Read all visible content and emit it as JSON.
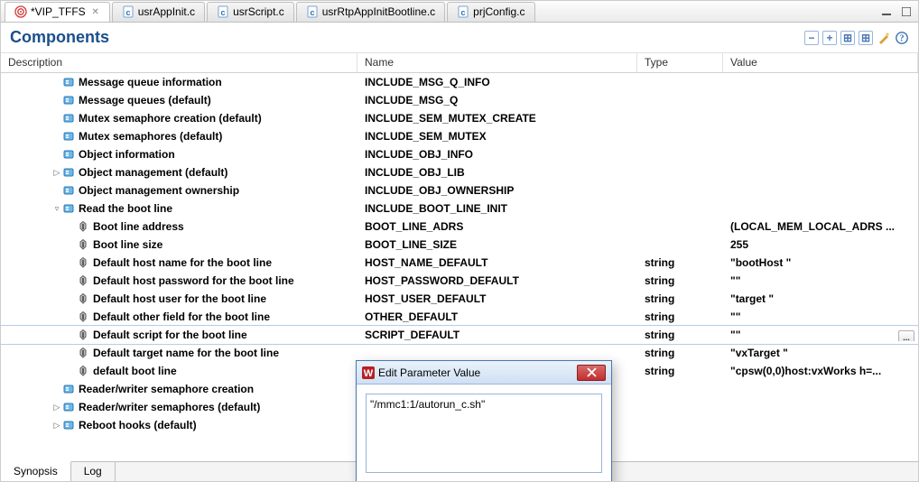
{
  "tabs": [
    {
      "label": "*VIP_TFFS",
      "active": true,
      "close": true,
      "icon": "target"
    },
    {
      "label": "usrAppInit.c",
      "icon": "cfile"
    },
    {
      "label": "usrScript.c",
      "icon": "cfile"
    },
    {
      "label": "usrRtpAppInitBootline.c",
      "icon": "cfile"
    },
    {
      "label": "prjConfig.c",
      "icon": "cfile"
    }
  ],
  "section_title": "Components",
  "columns": {
    "desc": "Description",
    "name": "Name",
    "type": "Type",
    "val": "Value"
  },
  "rows": [
    {
      "indent": 3,
      "twisty": "",
      "icon": "comp",
      "desc": "Message queue information",
      "name": "INCLUDE_MSG_Q_INFO",
      "type": "",
      "val": "",
      "bold": true
    },
    {
      "indent": 3,
      "twisty": "",
      "icon": "comp",
      "desc": "Message queues (default)",
      "name": "INCLUDE_MSG_Q",
      "type": "",
      "val": "",
      "bold": true
    },
    {
      "indent": 3,
      "twisty": "",
      "icon": "comp",
      "desc": "Mutex semaphore creation (default)",
      "name": "INCLUDE_SEM_MUTEX_CREATE",
      "type": "",
      "val": "",
      "bold": true
    },
    {
      "indent": 3,
      "twisty": "",
      "icon": "comp",
      "desc": "Mutex semaphores (default)",
      "name": "INCLUDE_SEM_MUTEX",
      "type": "",
      "val": "",
      "bold": true
    },
    {
      "indent": 3,
      "twisty": "",
      "icon": "comp",
      "desc": "Object information",
      "name": "INCLUDE_OBJ_INFO",
      "type": "",
      "val": "",
      "bold": true
    },
    {
      "indent": 3,
      "twisty": "▷",
      "icon": "comp",
      "desc": "Object management (default)",
      "name": "INCLUDE_OBJ_LIB",
      "type": "",
      "val": "",
      "bold": true
    },
    {
      "indent": 3,
      "twisty": "",
      "icon": "comp",
      "desc": "Object management ownership",
      "name": "INCLUDE_OBJ_OWNERSHIP",
      "type": "",
      "val": "",
      "bold": true
    },
    {
      "indent": 3,
      "twisty": "▿",
      "icon": "comp",
      "desc": "Read the boot line",
      "name": "INCLUDE_BOOT_LINE_INIT",
      "type": "",
      "val": "",
      "bold": true
    },
    {
      "indent": 4,
      "twisty": "",
      "icon": "param",
      "desc": "Boot line address",
      "name": "BOOT_LINE_ADRS",
      "type": "",
      "val": "(LOCAL_MEM_LOCAL_ADRS ...",
      "bold": true
    },
    {
      "indent": 4,
      "twisty": "",
      "icon": "param",
      "desc": "Boot line size",
      "name": "BOOT_LINE_SIZE",
      "type": "",
      "val": "255",
      "bold": true
    },
    {
      "indent": 4,
      "twisty": "",
      "icon": "param",
      "desc": "Default host name for the boot line",
      "name": "HOST_NAME_DEFAULT",
      "type": "string",
      "val": "\"bootHost \"",
      "bold": true
    },
    {
      "indent": 4,
      "twisty": "",
      "icon": "param",
      "desc": "Default host password for the boot line",
      "name": "HOST_PASSWORD_DEFAULT",
      "type": "string",
      "val": "\"\"",
      "bold": true
    },
    {
      "indent": 4,
      "twisty": "",
      "icon": "param",
      "desc": "Default host user for the boot line",
      "name": "HOST_USER_DEFAULT",
      "type": "string",
      "val": "\"target \"",
      "bold": true
    },
    {
      "indent": 4,
      "twisty": "",
      "icon": "param",
      "desc": "Default other field for the boot line",
      "name": "OTHER_DEFAULT",
      "type": "string",
      "val": "\"\"",
      "bold": true
    },
    {
      "indent": 4,
      "twisty": "",
      "icon": "param",
      "desc": "Default script for the boot line",
      "name": "SCRIPT_DEFAULT",
      "type": "string",
      "val": "\"\"",
      "bold": true,
      "selected": true,
      "browse": true
    },
    {
      "indent": 4,
      "twisty": "",
      "icon": "param",
      "desc": "Default target name for the boot line",
      "name": "",
      "type": "string",
      "val": "\"vxTarget \"",
      "bold": true
    },
    {
      "indent": 4,
      "twisty": "",
      "icon": "param",
      "desc": "default boot line",
      "name": "",
      "type": "string",
      "val": "\"cpsw(0,0)host:vxWorks h=...",
      "bold": true
    },
    {
      "indent": 3,
      "twisty": "",
      "icon": "comp",
      "desc": "Reader/writer semaphore creation",
      "name": "",
      "type": "",
      "val": "",
      "bold": true
    },
    {
      "indent": 3,
      "twisty": "▷",
      "icon": "comp",
      "desc": "Reader/writer semaphores (default)",
      "name": "",
      "type": "",
      "val": "",
      "bold": true
    },
    {
      "indent": 3,
      "twisty": "▷",
      "icon": "comp",
      "desc": "Reboot hooks (default)",
      "name": "",
      "type": "",
      "val": "",
      "bold": true
    }
  ],
  "bottom_tabs": [
    {
      "label": "Synopsis",
      "active": true
    },
    {
      "label": "Log"
    }
  ],
  "dialog": {
    "title": "Edit Parameter Value",
    "value": "\"/mmc1:1/autorun_c.sh\""
  },
  "icons": {
    "comp": "comp",
    "param": "param",
    "cfile": "cfile",
    "target": "target",
    "minimize": "minimize",
    "maximize": "maximize",
    "collapse": "collapse",
    "expand": "expand",
    "expand2": "expand2",
    "expand3": "expand3",
    "wizard": "wizard",
    "help": "help"
  }
}
